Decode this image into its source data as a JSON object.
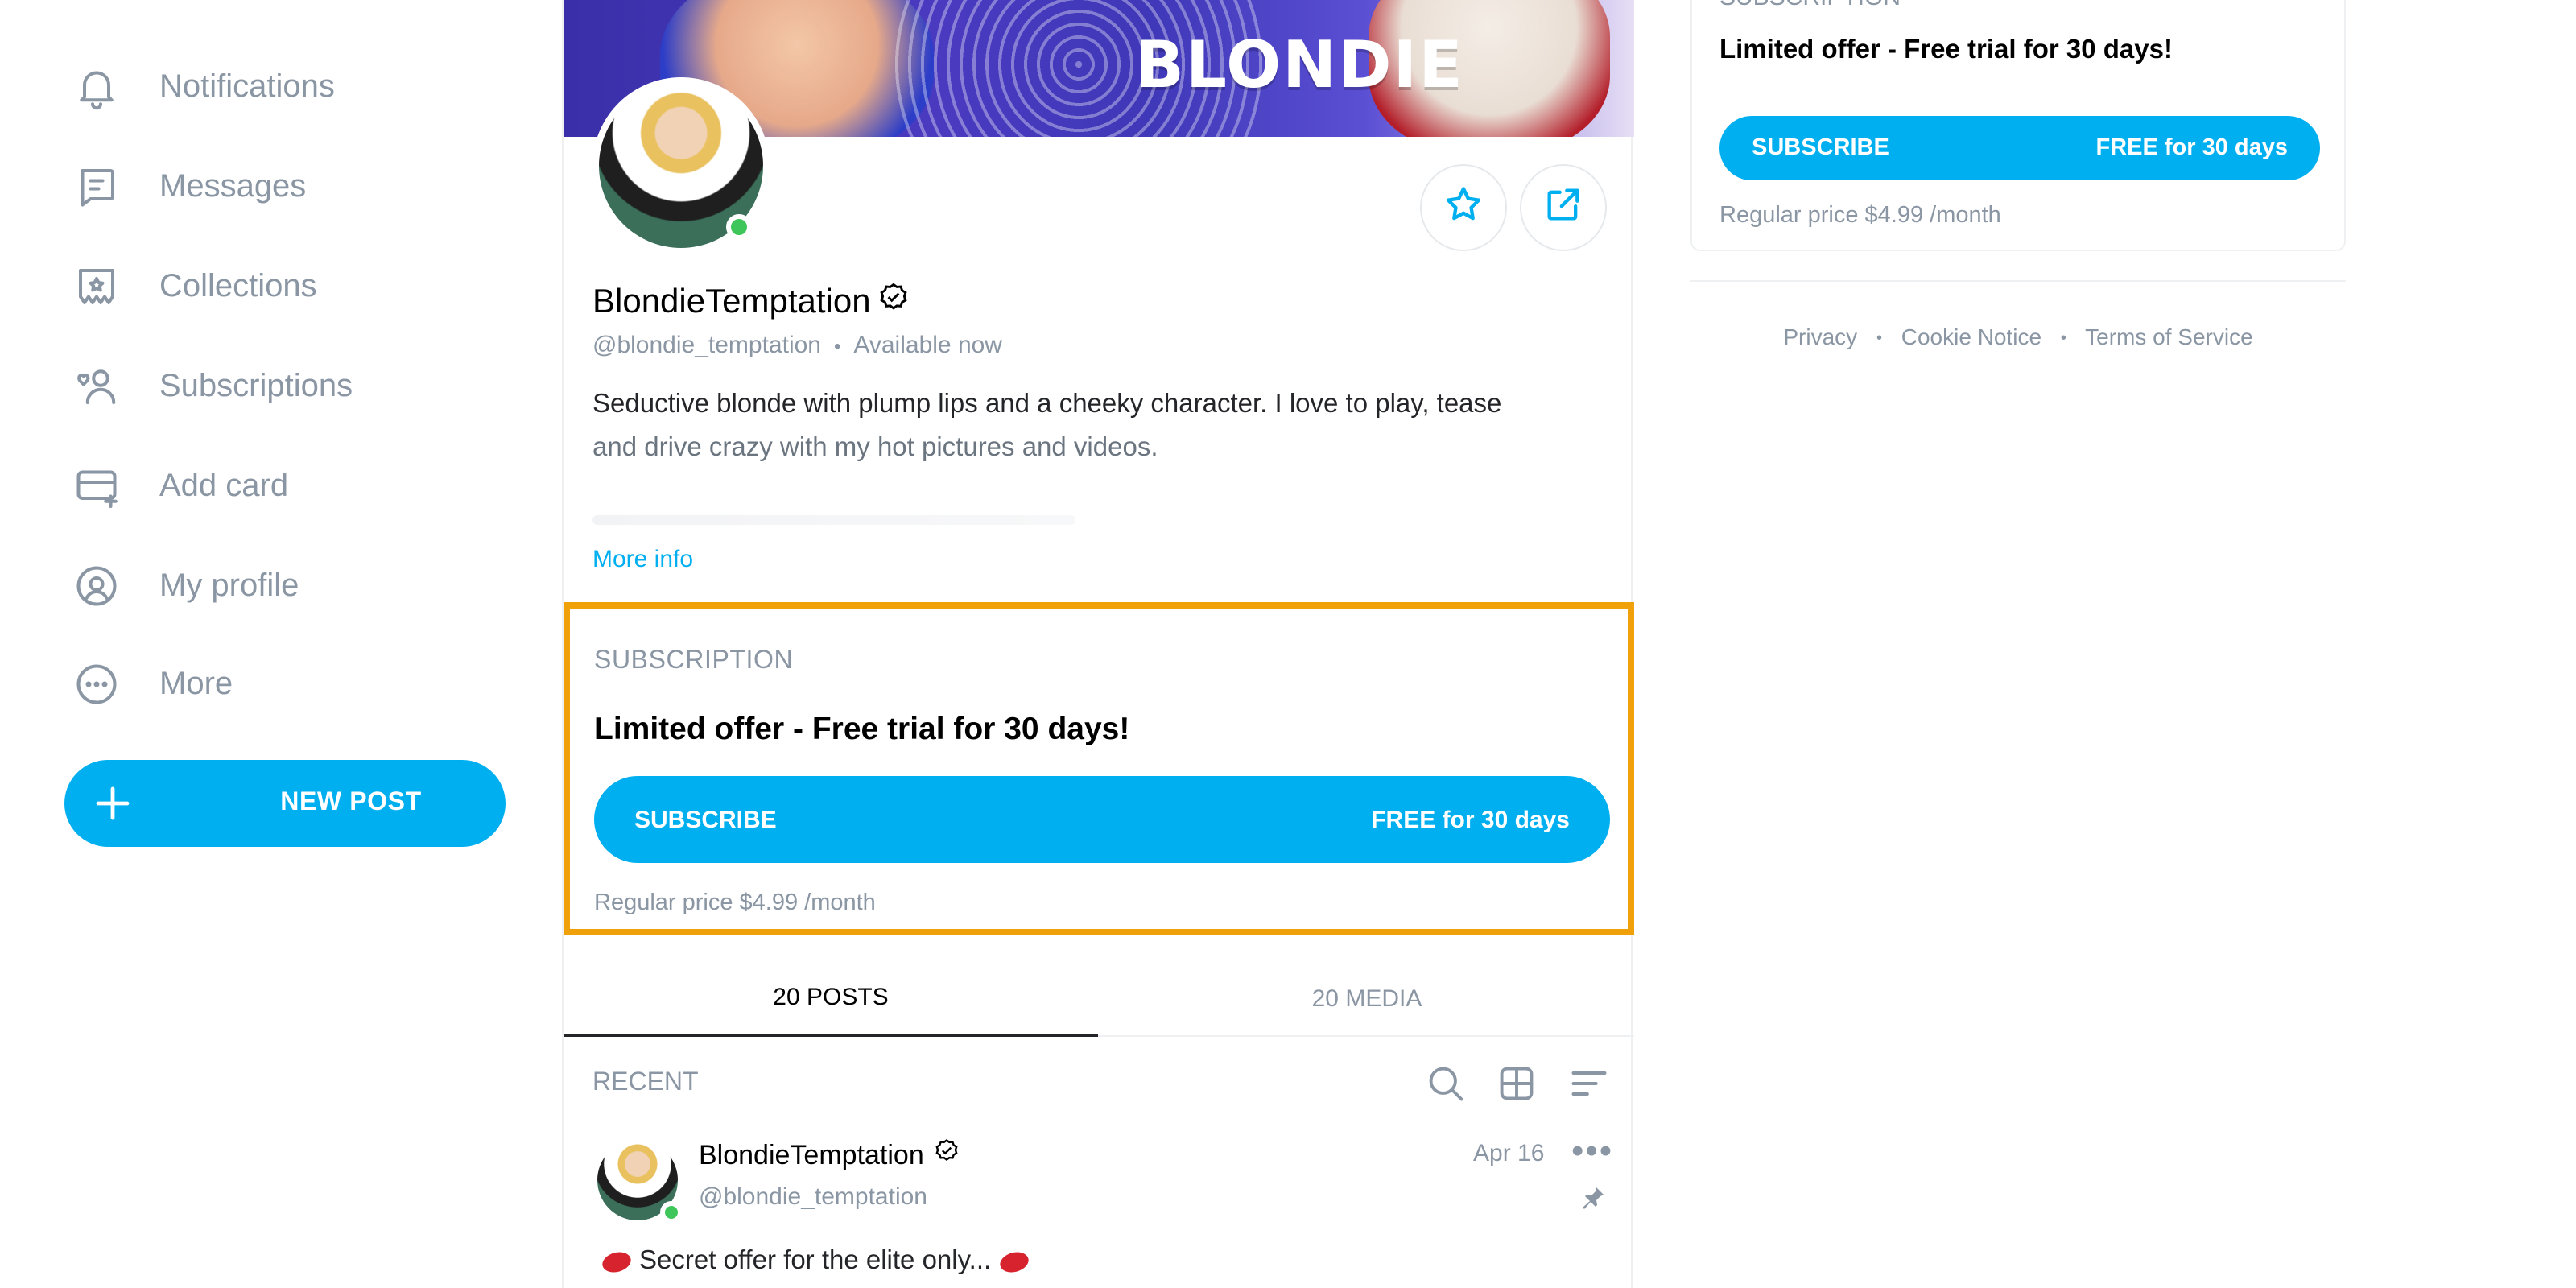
{
  "nav": {
    "items": [
      {
        "label": "Notifications",
        "icon": "bell-icon"
      },
      {
        "label": "Messages",
        "icon": "message-icon"
      },
      {
        "label": "Collections",
        "icon": "collections-icon"
      },
      {
        "label": "Subscriptions",
        "icon": "subscriptions-icon"
      },
      {
        "label": "Add card",
        "icon": "card-icon"
      },
      {
        "label": "My profile",
        "icon": "profile-icon"
      },
      {
        "label": "More",
        "icon": "more-icon"
      }
    ],
    "new_post_label": "NEW POST"
  },
  "profile": {
    "banner_text": "BLONDIE",
    "name": "BlondieTemptation",
    "handle": "@blondie_temptation",
    "status": "Available now",
    "bio_line1": "Seductive blonde with plump lips and a cheeky character. I love to play, tease",
    "bio_line2": "and drive crazy with my hot pictures and videos.",
    "more_info": "More info"
  },
  "subscription": {
    "label": "SUBSCRIPTION",
    "title": "Limited offer - Free trial for 30 days!",
    "button_left": "SUBSCRIBE",
    "button_right": "FREE for 30 days",
    "regular_price": "Regular price $4.99 /month"
  },
  "tabs": [
    {
      "label": "20 POSTS",
      "active": true
    },
    {
      "label": "20 MEDIA",
      "active": false
    }
  ],
  "feed": {
    "section_label": "RECENT",
    "post": {
      "author": "BlondieTemptation",
      "handle": "@blondie_temptation",
      "date": "Apr 16",
      "more": "•••",
      "text": "Secret offer for the elite only..."
    }
  },
  "sidebar_card": {
    "label": "SUBSCRIPTION",
    "title": "Limited offer - Free trial for 30 days!",
    "button_left": "SUBSCRIBE",
    "button_right": "FREE for 30 days",
    "regular_price": "Regular price $4.99 /month"
  },
  "footer": {
    "links": [
      "Privacy",
      "Cookie Notice",
      "Terms of Service"
    ],
    "separator": "•"
  },
  "colors": {
    "accent": "#00aff0",
    "highlight_border": "#f0a10a",
    "online": "#3ec65a",
    "muted": "#8a96a3"
  }
}
